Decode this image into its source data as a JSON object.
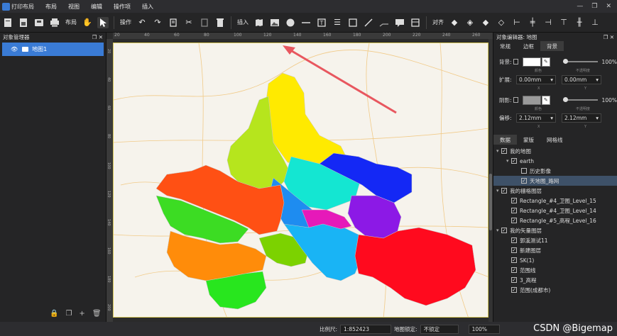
{
  "menubar": {
    "app_title": "打印布局",
    "items": [
      "布局",
      "视图",
      "编辑",
      "操作项",
      "插入"
    ]
  },
  "toolbar": {
    "layout_label": "布局",
    "operate_label": "操作",
    "insert_label": "插入",
    "align_label": "对齐"
  },
  "left_panel": {
    "title": "对象管理器",
    "items": [
      {
        "label": "地图1"
      }
    ]
  },
  "ruler": {
    "h_ticks": [
      "20",
      "40",
      "60",
      "80",
      "100",
      "120",
      "140",
      "160",
      "180",
      "200",
      "220",
      "240",
      "260",
      "280",
      "300"
    ],
    "v_ticks": [
      "20",
      "40",
      "60",
      "80",
      "100",
      "120",
      "140",
      "160",
      "180",
      "200"
    ]
  },
  "right_panel": {
    "title": "对象编辑器: 地图",
    "tabs": [
      "常规",
      "边框",
      "背景"
    ],
    "active_tab": "背景",
    "background": {
      "label": "背景:",
      "color": "#ffffff",
      "opacity": "100%",
      "color_caption": "颜色",
      "opacity_caption": "不透明度"
    },
    "expand": {
      "label": "扩展:",
      "x": "0.00mm",
      "y": "0.00mm",
      "x_caption": "X",
      "y_caption": "Y"
    },
    "shadow": {
      "label": "阴影:",
      "color": "#9a9a9a",
      "opacity": "100%",
      "color_caption": "颜色",
      "opacity_caption": "不透明度"
    },
    "offset": {
      "label": "偏移:",
      "x": "2.12mm",
      "y": "2.12mm",
      "x_caption": "X",
      "y_caption": "Y"
    },
    "lower_tabs": [
      "数据",
      "蒙版",
      "网格线"
    ],
    "layers": [
      {
        "label": "我的地图",
        "level": 0,
        "toggle": "▾",
        "checked": true,
        "selected": false
      },
      {
        "label": "earth",
        "level": 1,
        "toggle": "▾",
        "checked": true,
        "selected": false
      },
      {
        "label": "历史影像",
        "level": 2,
        "toggle": "",
        "checked": false,
        "selected": false
      },
      {
        "label": "天地图_路网",
        "level": 2,
        "toggle": "",
        "checked": true,
        "selected": true
      },
      {
        "label": "我的栅格图层",
        "level": 0,
        "toggle": "▾",
        "checked": true,
        "selected": false
      },
      {
        "label": "Rectangle_#4_卫图_Level_15",
        "level": 1,
        "toggle": "",
        "checked": true,
        "selected": false
      },
      {
        "label": "Rectangle_#4_卫图_Level_14",
        "level": 1,
        "toggle": "",
        "checked": true,
        "selected": false
      },
      {
        "label": "Rectangle_#5_高程_Level_16",
        "level": 1,
        "toggle": "",
        "checked": true,
        "selected": false
      },
      {
        "label": "我的矢量图层",
        "level": 0,
        "toggle": "▾",
        "checked": true,
        "selected": false
      },
      {
        "label": "郭溪测试11",
        "level": 1,
        "toggle": "",
        "checked": true,
        "selected": false
      },
      {
        "label": "新建图层",
        "level": 1,
        "toggle": "",
        "checked": true,
        "selected": false
      },
      {
        "label": "SK(1)",
        "level": 1,
        "toggle": "",
        "checked": true,
        "selected": false
      },
      {
        "label": "范围线",
        "level": 1,
        "toggle": "",
        "checked": true,
        "selected": false
      },
      {
        "label": "3_高程",
        "level": 1,
        "toggle": "",
        "checked": true,
        "selected": false
      },
      {
        "label": "范围(成都市)",
        "level": 1,
        "toggle": "",
        "checked": true,
        "selected": false
      }
    ]
  },
  "statusbar": {
    "scale_label": "比例尺:",
    "scale_value": "1:852423",
    "lock_label": "地图锁定:",
    "lock_value": "不锁定",
    "zoom_value": "100%"
  },
  "watermark": "CSDN @Bigemap",
  "colors": {
    "accent": "#3a7bd5",
    "arrow": "#e8575f"
  }
}
